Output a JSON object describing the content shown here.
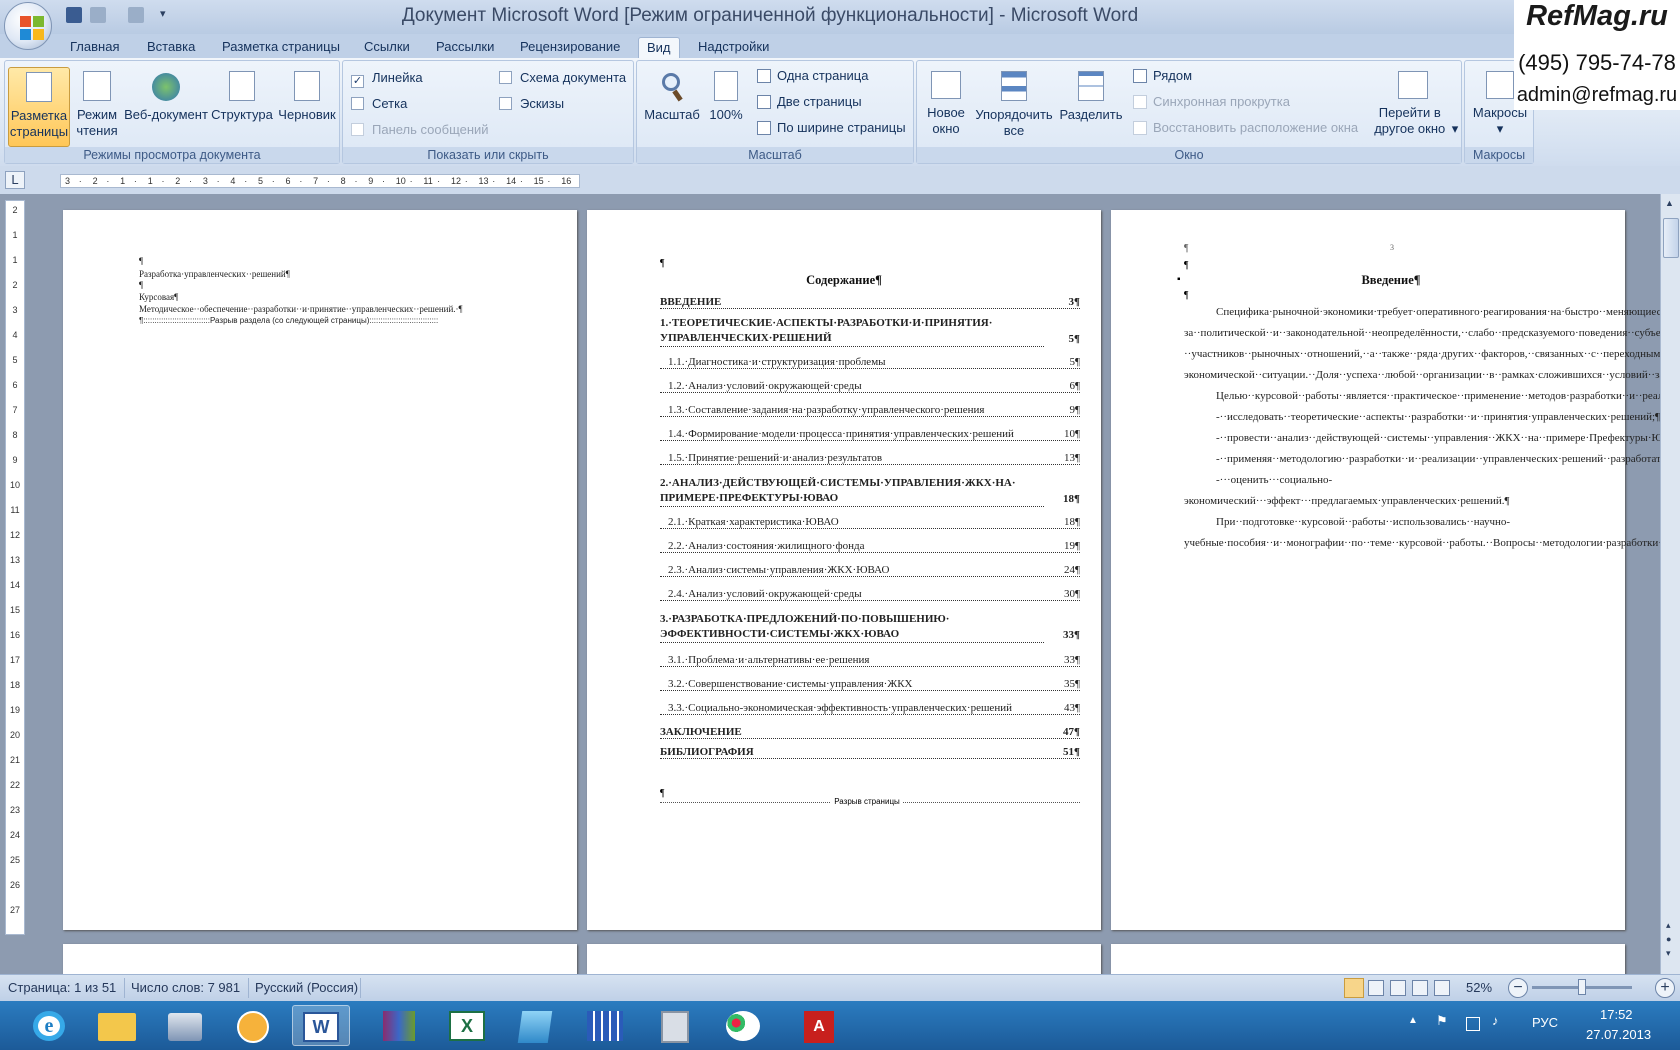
{
  "window": {
    "title": "Документ Microsoft Word [Режим ограниченной функциональности] - Microsoft Word"
  },
  "brand": {
    "name": "RefMag.ru",
    "phone": "(495) 795-74-78",
    "email": "admin@refmag.ru"
  },
  "tabs": [
    "Главная",
    "Вставка",
    "Разметка страницы",
    "Ссылки",
    "Рассылки",
    "Рецензирование",
    "Вид",
    "Надстройки"
  ],
  "ribbon": {
    "views": {
      "label": "Режимы просмотра документа",
      "buttons": [
        "Разметка страницы",
        "Режим чтения",
        "Веб-документ",
        "Структура",
        "Черновик"
      ]
    },
    "show": {
      "label": "Показать или скрыть",
      "ruler": "Линейка",
      "grid": "Сетка",
      "messagebar": "Панель сообщений",
      "docmap": "Схема документа",
      "thumbs": "Эскизы"
    },
    "zoom": {
      "label": "Масштаб",
      "zoom_btn": "Масштаб",
      "pct_btn": "100%",
      "one_page": "Одна страница",
      "two_pages": "Две страницы",
      "page_width": "По ширине страницы"
    },
    "window": {
      "label": "Окно",
      "new_window": "Новое окно",
      "arrange_all": "Упорядочить все",
      "split": "Разделить",
      "side_by_side": "Рядом",
      "sync_scroll": "Синхронная прокрутка",
      "reset_pos": "Восстановить расположение окна",
      "switch": "Перейти в другое окно"
    },
    "macros": {
      "label": "Макросы",
      "button": "Макросы"
    }
  },
  "ruler": {
    "corner": "L",
    "hticks": [
      "3",
      "·",
      "2",
      "·",
      "1",
      "·",
      "1",
      "·",
      "2",
      "·",
      "3",
      "·",
      "4",
      "·",
      "5",
      "·",
      "6",
      "·",
      "7",
      "·",
      "8",
      "·",
      "9",
      "·",
      "10",
      "·",
      "11",
      "·",
      "12",
      "·",
      "13",
      "·",
      "14",
      "·",
      "15",
      "·",
      "16"
    ],
    "vticks": [
      "2",
      "1",
      "1",
      "2",
      "3",
      "4",
      "5",
      "6",
      "7",
      "8",
      "9",
      "10",
      "11",
      "12",
      "13",
      "14",
      "15",
      "16",
      "17",
      "18",
      "19",
      "20",
      "21",
      "22",
      "23",
      "24",
      "25",
      "26",
      "27"
    ]
  },
  "page1": {
    "lines": [
      "¶",
      "Разработка·управленческих··решений¶",
      "¶",
      "Курсовая¶",
      "Методическое··обеспечение··разработки··и·принятие··управленческих··решений.·¶",
      "¶::::::::::::::::::::::::::::::Разрыв раздела (со следующей страницы):::::::::::::::::::::::::::::::"
    ]
  },
  "page2": {
    "pilcrow": "¶",
    "title": "Содержание¶",
    "toc": [
      {
        "text": "ВВЕДЕНИЕ",
        "page": "3¶",
        "bold": true
      },
      {
        "text": "1.·ТЕОРЕТИЧЕСКИЕ·АСПЕКТЫ·РАЗРАБОТКИ·И·ПРИНЯТИЯ·",
        "text2": "УПРАВЛЕНЧЕСКИХ·РЕШЕНИЙ",
        "page": "5¶",
        "bold": true
      },
      {
        "text": "1.1.·Диагностика·и·структуризация·проблемы",
        "page": "5¶"
      },
      {
        "text": "1.2.·Анализ·условий·окружающей·среды",
        "page": "6¶"
      },
      {
        "text": "1.3.·Составление·задания·на·разработку·управленческого·решения",
        "page": "9¶"
      },
      {
        "text": "1.4.·Формирование·модели·процесса·принятия·управленческих·решений",
        "page": "10¶"
      },
      {
        "text": "1.5.·Принятие·решений·и·анализ·результатов",
        "page": "13¶"
      },
      {
        "text": "2.·АНАЛИЗ·ДЕЙСТВУЮЩЕЙ·СИСТЕМЫ·УПРАВЛЕНИЯ·ЖКХ·НА·",
        "text2": "ПРИМЕРЕ·ПРЕФЕКТУРЫ·ЮВАО",
        "page": "18¶",
        "bold": true
      },
      {
        "text": "2.1.·Краткая·характеристика·ЮВАО",
        "page": "18¶"
      },
      {
        "text": "2.2.·Анализ·состояния·жилищного·фонда",
        "page": "19¶"
      },
      {
        "text": "2.3.·Анализ·системы·управления·ЖКХ·ЮВАО",
        "page": "24¶"
      },
      {
        "text": "2.4.·Анализ·условий·окружающей·среды",
        "page": "30¶"
      },
      {
        "text": "3.·РАЗРАБОТКА·ПРЕДЛОЖЕНИЙ·ПО·ПОВЫШЕНИЮ·",
        "text2": "ЭФФЕКТИВНОСТИ·СИСТЕМЫ·ЖКХ·ЮВАО",
        "page": "33¶",
        "bold": true
      },
      {
        "text": "3.1.·Проблема·и·альтернативы·ее·решения",
        "page": "33¶"
      },
      {
        "text": "3.2.·Совершенствование·системы·управления·ЖКХ",
        "page": "35¶"
      },
      {
        "text": "3.3.·Социально-экономическая·эффективность·управленческих·решений",
        "page": "43¶"
      },
      {
        "text": "ЗАКЛЮЧЕНИЕ",
        "page": "47¶",
        "bold": true
      },
      {
        "text": "БИБЛИОГРАФИЯ",
        "page": "51¶",
        "bold": true
      }
    ],
    "end_pilcrow": "¶",
    "page_break": "Разрыв страницы"
  },
  "page3": {
    "page_num": "3",
    "pilcrow": "¶",
    "title": "Введение¶",
    "paragraphs": [
      "Специфика·рыночной·экономики·требует·оперативного·реагирования·на·быстро··меняющиеся··условия··внешней··среды,··работы··в··условиях·нестабильности.·Степень··неопределённости··и··риска··возрастает··в··частности··из-за··политической··и··законодательной··неопределённости,··слабо··предсказуемого·поведения··субъектов··рынка··–··участников··рыночных··отношений,··а··также··ряда·других··факторов,··связанных··с··переходным··состоянием··отечественной·социально-экономической··ситуации.··Доля··успеха··любой··организации··в··рамках·сложившихся··условий··зависит··от··эффективности··используемой··ею··системы·управления,··умения··гибко··реагировать··на··динамично··развивающиеся··условия·внешней·среды,·принимать··адекватные,··взвешенные··управленческие··°решения.¶",
      "Целью··курсовой··работы··является··практическое··применение··методов·разработки··и··реализации··управленческих··решений.··В··соответствие··с·поставленной·целью·решаются·следующие·задачи:¶",
      "-··исследовать··теоретические··аспекты··разработки··и··принятия·управленческих·решений;¶",
      "-··провести··анализ··действующей··системы··управления··ЖКХ··на··примере·Префектуры·ЮВАО;¶",
      "-··применяя··методологию··разработки··и··реализации··управленческих·решений··разработать···предложения··по··повышению··эффективности··системы·ЖКХ·ЮВАО;¶",
      "-···оценить···социально-экономический···эффект···предлагаемых·управленческих·решений.¶",
      "При··подготовке··курсовой··работы··использовались··научно-учебные·пособия··и··монографии··по··теме··курсовой··работы.··Вопросы··методологии·разработки··реализации··управленческих··решений··исследовались··Е.··П.·Голубковым,··А.М.··Дубровым,··Б.А.··Лагошей,··Е.Ю.··Хрусталевым,··Т.П.·Барановской,··Н.В.··Князевской,··В.С.··Князевским,··Л.Г.··Лабскером,··Е.В.·Яновской,·Р.·А.·Фатхутдиновым·и·др.·учеными.¶"
    ]
  },
  "status": {
    "page": "Страница: 1 из 51",
    "words": "Число слов: 7 981",
    "lang": "Русский (Россия)",
    "zoom": "52%"
  },
  "tray": {
    "lang": "РУС",
    "time": "17:52",
    "date": "27.07.2013"
  },
  "colors": {
    "ribbon_bg": "#dae5f3",
    "active_btn": "#ffc758",
    "taskbar": "#1c5a98",
    "doc_bg": "#8d9bb0"
  }
}
